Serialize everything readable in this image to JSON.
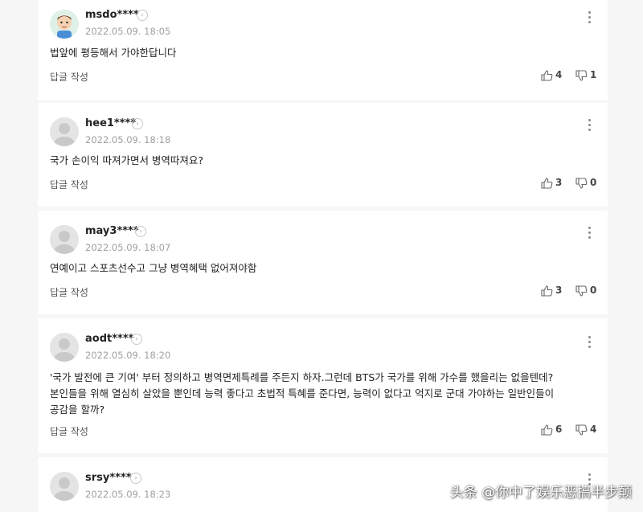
{
  "comments": [
    {
      "username": "msdo****",
      "date": "2022.05.09. 18:05",
      "text": "법앞에 평등해서 가야한답니다",
      "reply_label": "답글 작성",
      "likes": "4",
      "dislikes": "1",
      "avatar": "cartoon-avatar"
    },
    {
      "username": "hee1****",
      "date": "2022.05.09. 18:18",
      "text": "국가 손이익 따져가면서 병역따져요?",
      "reply_label": "답글 작성",
      "likes": "3",
      "dislikes": "0",
      "avatar": "default-avatar"
    },
    {
      "username": "may3****",
      "date": "2022.05.09. 18:07",
      "text": "연예이고 스포츠선수고 그냥 병역혜택 없어져야함",
      "reply_label": "답글 작성",
      "likes": "3",
      "dislikes": "0",
      "avatar": "default-avatar"
    },
    {
      "username": "aodt****",
      "date": "2022.05.09. 18:20",
      "text": "'국가 발전에 큰 기여' 부터 정의하고 병역면제특례를 주든지 하자.그런데 BTS가 국가를 위해 가수를 했을리는 없을텐데?\n본인들을 위해 열심히 살았을 뿐인데 능력 좋다고 초법적 특혜를 준다면, 능력이 없다고 억지로 군대 가야하는 일반인들이\n공감을 할까?",
      "reply_label": "답글 작성",
      "likes": "6",
      "dislikes": "4",
      "avatar": "default-avatar"
    },
    {
      "username": "srsy****",
      "date": "2022.05.09. 18:23",
      "text": "",
      "reply_label": "",
      "likes": "",
      "dislikes": "",
      "avatar": "default-avatar"
    }
  ],
  "watermark": "头条 @你中了娱乐恶搞半步颠",
  "colors": {
    "page_bg": "#f6f6f6",
    "card_bg": "#ffffff",
    "date_gray": "#a0a0a0"
  },
  "icons": {
    "like": "thumbs-up-icon",
    "dislike": "thumbs-down-icon",
    "more": "more-vertical-icon",
    "profile_arrow": "chevron-right-icon"
  }
}
